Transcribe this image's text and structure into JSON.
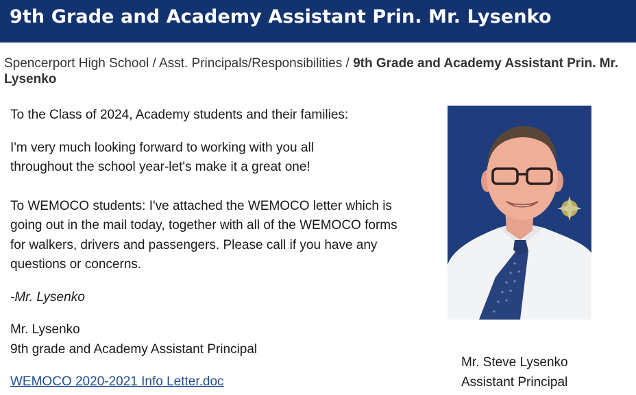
{
  "header": {
    "title": "9th Grade and Academy Assistant Prin. Mr. Lysenko"
  },
  "breadcrumb": {
    "items": [
      "Spencerport High School",
      "Asst. Principals/Responsibilities"
    ],
    "separator": " / ",
    "current": "9th Grade and Academy Assistant Prin. Mr. Lysenko"
  },
  "content": {
    "greeting": "To the Class of 2024, Academy students and their families:",
    "paragraph1": "I'm very much looking forward to working with you all throughout the school year-let's make it a great one!",
    "paragraph2": "To WEMOCO students: I've attached the WEMOCO letter which is going out in the mail today, together with all of the WEMOCO forms for walkers, drivers and passengers.  Please call if you have any questions or concerns.",
    "signoff": "-Mr. Lysenko",
    "signature_name": "Mr. Lysenko",
    "signature_title": "9th grade and Academy Assistant Principal",
    "attachment_link": "WEMOCO 2020-2021 Info Letter.doc"
  },
  "photo": {
    "caption_name": "Mr. Steve Lysenko",
    "caption_title": "Assistant Principal"
  },
  "colors": {
    "header_bg": "#12336f",
    "link": "#1f4c93",
    "photo_bg": "#1e3c7a"
  }
}
